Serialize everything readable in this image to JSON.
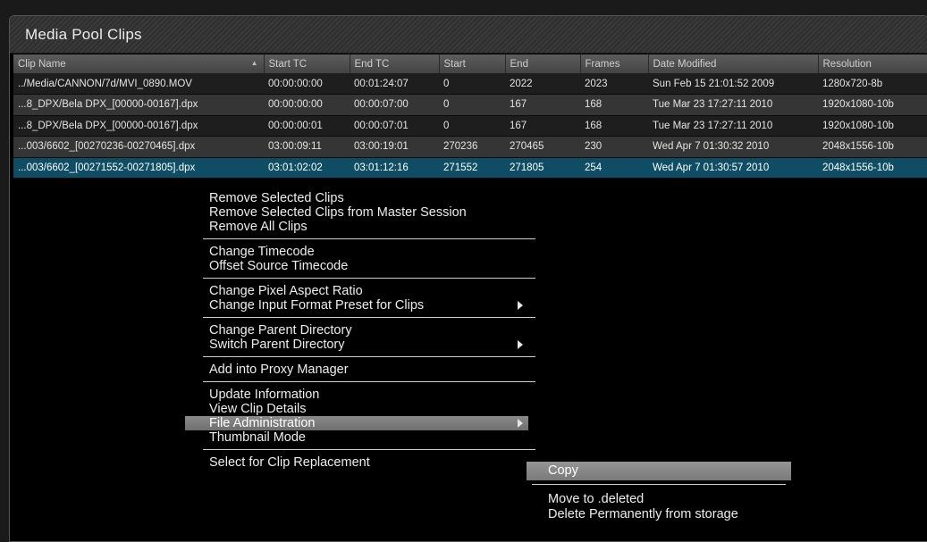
{
  "panel": {
    "title": "Media Pool Clips"
  },
  "table": {
    "columns": [
      "Clip Name",
      "Start TC",
      "End TC",
      "Start",
      "End",
      "Frames",
      "Date Modified",
      "Resolution"
    ],
    "rows": [
      [
        "../Media/CANNON/7d/MVI_0890.MOV",
        "00:00:00:00",
        "00:01:24:07",
        "0",
        "2022",
        "2023",
        "Sun Feb 15 21:01:52 2009",
        "1280x720-8b"
      ],
      [
        "...8_DPX/Bela DPX_[00000-00167].dpx",
        "00:00:00:00",
        "00:00:07:00",
        "0",
        "167",
        "168",
        "Tue Mar 23 17:27:11 2010",
        "1920x1080-10b"
      ],
      [
        "...8_DPX/Bela DPX_[00000-00167].dpx",
        "00:00:00:01",
        "00:00:07:01",
        "0",
        "167",
        "168",
        "Tue Mar 23 17:27:11 2010",
        "1920x1080-10b"
      ],
      [
        "...003/6602_[00270236-00270465].dpx",
        "03:00:09:11",
        "03:00:19:01",
        "270236",
        "270465",
        "230",
        "Wed Apr  7 01:30:32 2010",
        "2048x1556-10b"
      ],
      [
        "...003/6602_[00271552-00271805].dpx",
        "03:01:02:02",
        "03:01:12:16",
        "271552",
        "271805",
        "254",
        "Wed Apr  7 01:30:57 2010",
        "2048x1556-10b"
      ]
    ]
  },
  "context_menu": {
    "groups": [
      [
        "Remove Selected Clips",
        "Remove Selected Clips from Master Session",
        "Remove All Clips"
      ],
      [
        "Change Timecode",
        "Offset Source Timecode"
      ],
      [
        "Change Pixel Aspect Ratio",
        "Change Input Format Preset for Clips"
      ],
      [
        "Change Parent Directory",
        "Switch Parent Directory"
      ],
      [
        "Add into Proxy Manager"
      ],
      [
        "Update Information",
        "View Clip Details",
        "File Administration",
        "Thumbnail Mode"
      ],
      [
        "Select for Clip Replacement"
      ]
    ],
    "highlighted": "File Administration"
  },
  "submenu": {
    "items": [
      "Copy",
      "Move to .deleted",
      "Delete Permanently from storage"
    ],
    "highlighted": "Copy"
  },
  "colors": {
    "selected_row": "#0e4d63",
    "panel_bg": "#000000",
    "highlight": "#7f7f7f"
  }
}
